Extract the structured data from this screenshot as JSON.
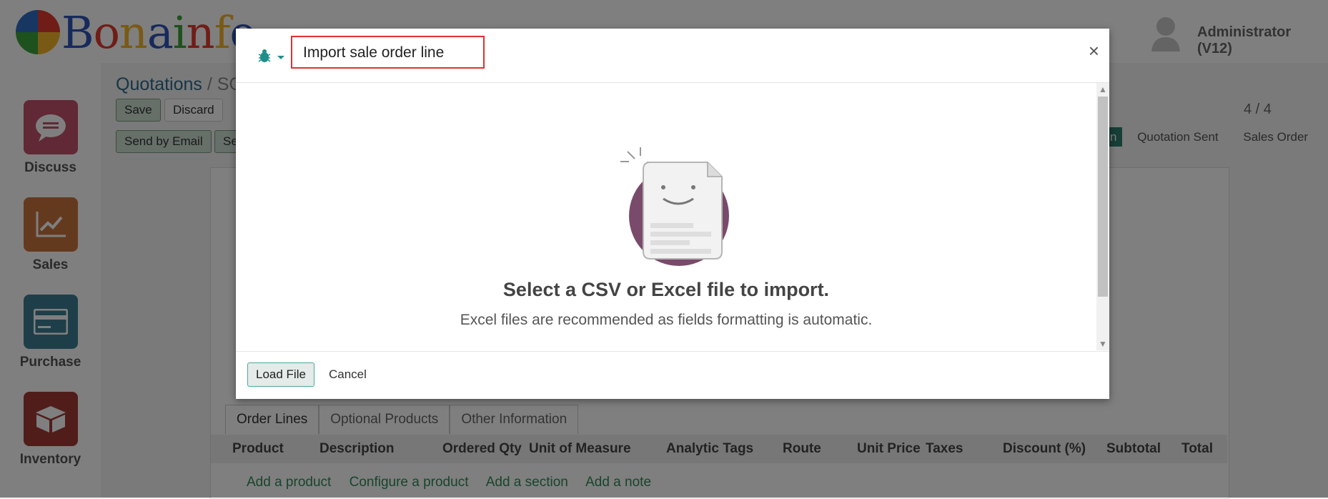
{
  "app": {
    "logo_text": "Bonainfo",
    "user_name": "Administrator (V12)"
  },
  "sidebar": {
    "items": [
      {
        "label": "Discuss",
        "icon": "chat-bubble-icon",
        "color": "#c0536a"
      },
      {
        "label": "Sales",
        "icon": "chart-trend-icon",
        "color": "#c9753f"
      },
      {
        "label": "Purchase",
        "icon": "credit-card-icon",
        "color": "#3d7f93"
      },
      {
        "label": "Inventory",
        "icon": "box-icon",
        "color": "#a03a36"
      }
    ]
  },
  "breadcrumb": {
    "root": "Quotations",
    "current": "/ SO"
  },
  "form_buttons": {
    "save": "Save",
    "discard": "Discard",
    "send_by_email": "Send by Email",
    "second": "Se"
  },
  "pager": {
    "text": "4 / 4"
  },
  "statusbar": {
    "items": [
      "n",
      "Quotation Sent",
      "Sales Order"
    ]
  },
  "tabs": [
    "Order Lines",
    "Optional Products",
    "Other Information"
  ],
  "table": {
    "columns": [
      "Product",
      "Description",
      "Ordered Qty",
      "Unit of Measure",
      "Analytic Tags",
      "Route",
      "Unit Price",
      "Taxes",
      "Discount (%)",
      "Subtotal",
      "Total"
    ],
    "add_links": [
      "Add a product",
      "Configure a product",
      "Add a section",
      "Add a note"
    ]
  },
  "modal": {
    "title": "Import sale order line",
    "close_symbol": "×",
    "empty_title": "Select a CSV or Excel file to import.",
    "empty_subtitle": "Excel files are recommended as fields formatting is automatic.",
    "load_file": "Load File",
    "cancel": "Cancel"
  }
}
